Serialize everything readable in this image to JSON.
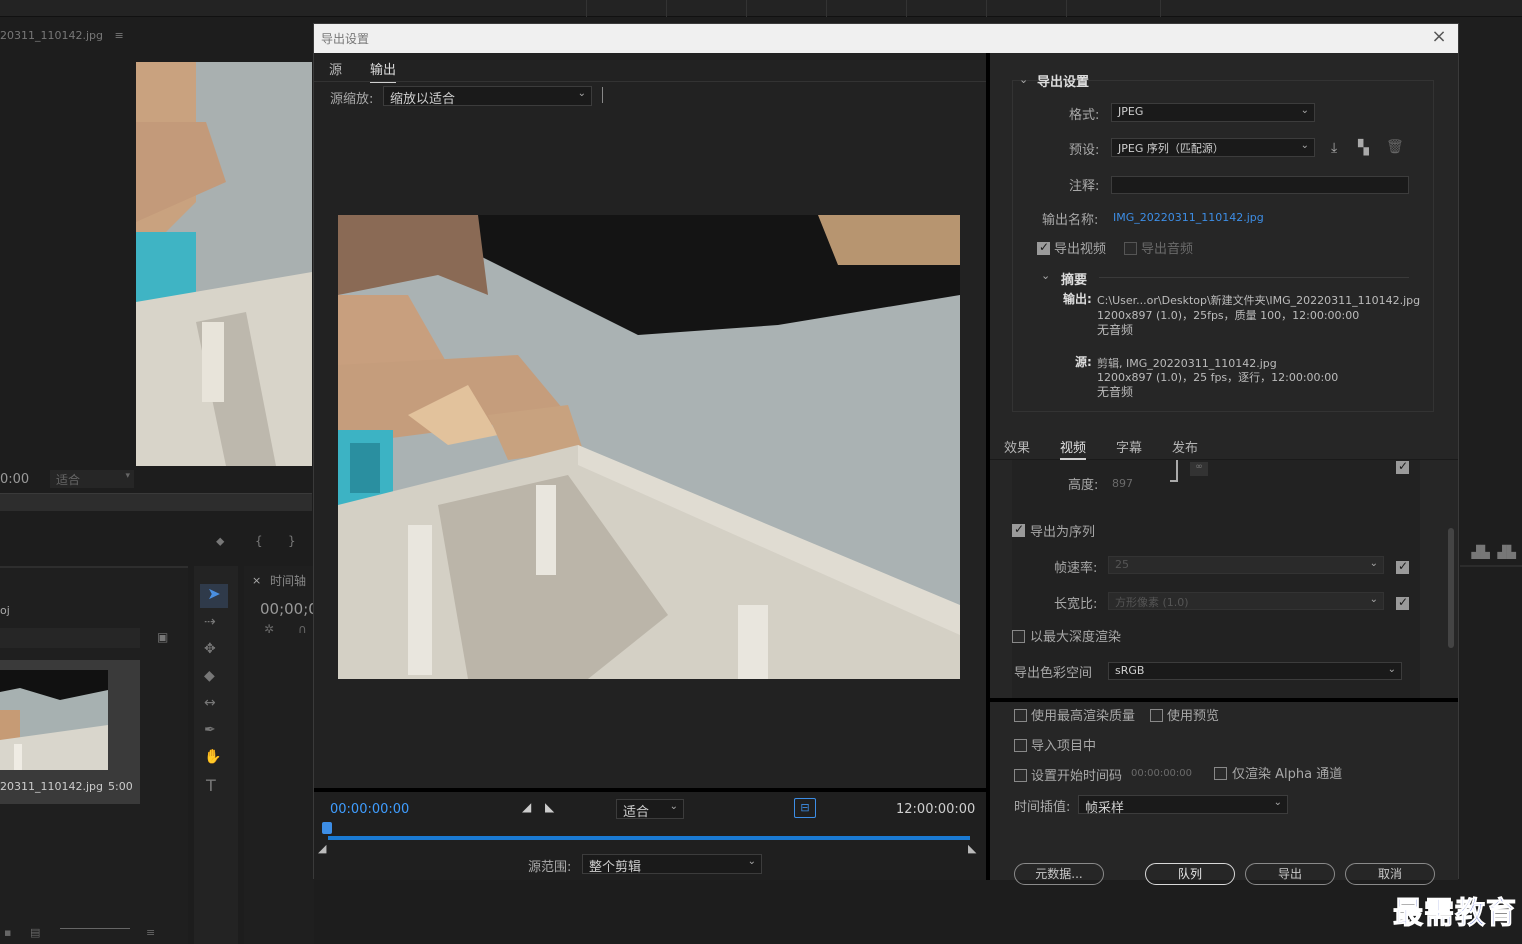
{
  "background_app": {
    "source_file_label": "20311_110142.jpg",
    "source_menu_glyph": "≡",
    "source_time": "0:00",
    "source_zoom": "适合",
    "project_name_fragment": "oj",
    "project_item_name": "20311_110142.jpg",
    "project_item_duration": "5:00",
    "timeline_tab_close": "×",
    "timeline_tab": "时间轴",
    "timeline_time": "00;00;0"
  },
  "dialog": {
    "title": "导出设置",
    "close_glyph": "×",
    "left": {
      "tabs": [
        "源",
        "输出"
      ],
      "active_tab": "输出",
      "source_scale_label": "源缩放:",
      "source_scale_value": "缩放以适合",
      "current_time": "00:00:00:00",
      "fit_value": "适合",
      "end_time": "12:00:00:00",
      "source_range_label": "源范围:",
      "source_range_value": "整个剪辑"
    },
    "right": {
      "section_title": "导出设置",
      "format_label": "格式:",
      "format_value": "JPEG",
      "preset_label": "预设:",
      "preset_value": "JPEG 序列（匹配源）",
      "comment_label": "注释:",
      "comment_value": "",
      "output_name_label": "输出名称:",
      "output_name_value": "IMG_20220311_110142.jpg",
      "export_video_label": "导出视频",
      "export_video_checked": true,
      "export_audio_label": "导出音频",
      "export_audio_checked": false,
      "summary_title": "摘要",
      "summary_output_label": "输出:",
      "summary_output_line1": "C:\\User...or\\Desktop\\新建文件夹\\IMG_20220311_110142.jpg",
      "summary_output_line2": "1200x897 (1.0)，25fps，质量 100，12:00:00:00",
      "summary_output_line3": "无音频",
      "summary_source_label": "源:",
      "summary_source_line1": "剪辑, IMG_20220311_110142.jpg",
      "summary_source_line2": "1200x897 (1.0)，25 fps，逐行，12:00:00:00",
      "summary_source_line3": "无音频",
      "subtabs": [
        "效果",
        "视频",
        "字幕",
        "发布"
      ],
      "active_subtab": "视频",
      "height_label": "高度:",
      "height_value": "897",
      "export_as_sequence_label": "导出为序列",
      "export_as_sequence_checked": true,
      "frame_rate_label": "帧速率:",
      "frame_rate_value": "25",
      "aspect_label": "长宽比:",
      "aspect_value": "方形像素 (1.0)",
      "max_depth_label": "以最大深度渲染",
      "max_depth_checked": false,
      "color_space_label": "导出色彩空间",
      "color_space_value": "sRGB",
      "max_quality_label": "使用最高渲染质量",
      "use_preview_label": "使用预览",
      "import_project_label": "导入项目中",
      "set_start_tc_label": "设置开始时间码",
      "start_tc_value": "00:00:00:00",
      "alpha_only_label": "仅渲染 Alpha 通道",
      "interp_label": "时间插值:",
      "interp_value": "帧采样",
      "btn_metadata": "元数据...",
      "btn_queue": "队列",
      "btn_export": "导出",
      "btn_cancel": "取消"
    }
  },
  "watermark": "最需教育",
  "colors": {
    "accent_blue": "#3d8ee6",
    "timeline_blue": "#1a7ad3",
    "dialog_bg": "#262626"
  }
}
